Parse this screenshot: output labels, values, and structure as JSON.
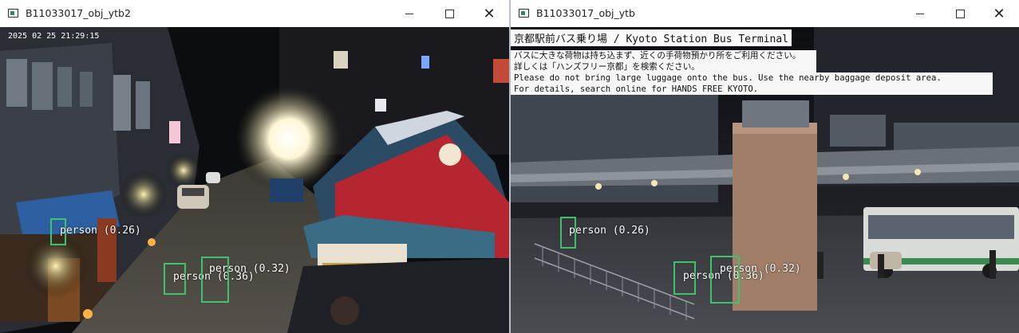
{
  "windows": [
    {
      "title": "B11033017_obj_ytb2",
      "controls": {
        "minimize_icon": "minimize-icon",
        "maximize_icon": "maximize-icon",
        "close_label": "✕"
      },
      "overlay": {
        "timestamp": "2025 02 25 21:29:15"
      },
      "detections": [
        {
          "label": "person (0.26)"
        },
        {
          "label": "person (0.36)"
        },
        {
          "label": "person (0.32)"
        }
      ]
    },
    {
      "title": "B11033017_obj_ytb",
      "controls": {
        "minimize_icon": "minimize-icon",
        "maximize_icon": "maximize-icon",
        "close_label": "✕"
      },
      "overlay": {
        "station_banner": "京都駅前バス乗り場 / Kyoto Station Bus Terminal",
        "notice_lines": [
          "バスに大きな荷物は持ち込まず、近くの手荷物預かり所をご利用ください。",
          "詳しくは「ハンズフリー京都」を検索ください。",
          "Please do not bring large luggage onto the bus. Use the nearby baggage deposit area.",
          "For details, search online for HANDS FREE KYOTO."
        ]
      },
      "detections": [
        {
          "label": "person (0.26)"
        },
        {
          "label": "person (0.36)"
        },
        {
          "label": "person (0.32)"
        }
      ]
    }
  ],
  "colors": {
    "detection_box": "#3fc26b",
    "window_bg": "#ffffff"
  }
}
